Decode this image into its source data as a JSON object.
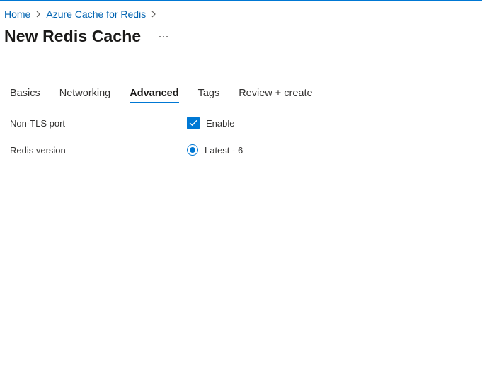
{
  "breadcrumb": {
    "items": [
      {
        "label": "Home"
      },
      {
        "label": "Azure Cache for Redis"
      }
    ]
  },
  "page": {
    "title": "New Redis Cache",
    "more_label": "More options"
  },
  "tabs": [
    {
      "label": "Basics",
      "active": false
    },
    {
      "label": "Networking",
      "active": false
    },
    {
      "label": "Advanced",
      "active": true
    },
    {
      "label": "Tags",
      "active": false
    },
    {
      "label": "Review + create",
      "active": false
    }
  ],
  "form": {
    "non_tls_port": {
      "label": "Non-TLS port",
      "control_label": "Enable",
      "checked": true
    },
    "redis_version": {
      "label": "Redis version",
      "selected_option": "Latest - 6"
    }
  },
  "colors": {
    "accent": "#0078d4",
    "link": "#0063b1",
    "text": "#323130"
  },
  "icons": {
    "breadcrumb_separator": "chevron-right-icon",
    "more": "ellipsis-icon",
    "checkbox": "checkmark-icon"
  }
}
